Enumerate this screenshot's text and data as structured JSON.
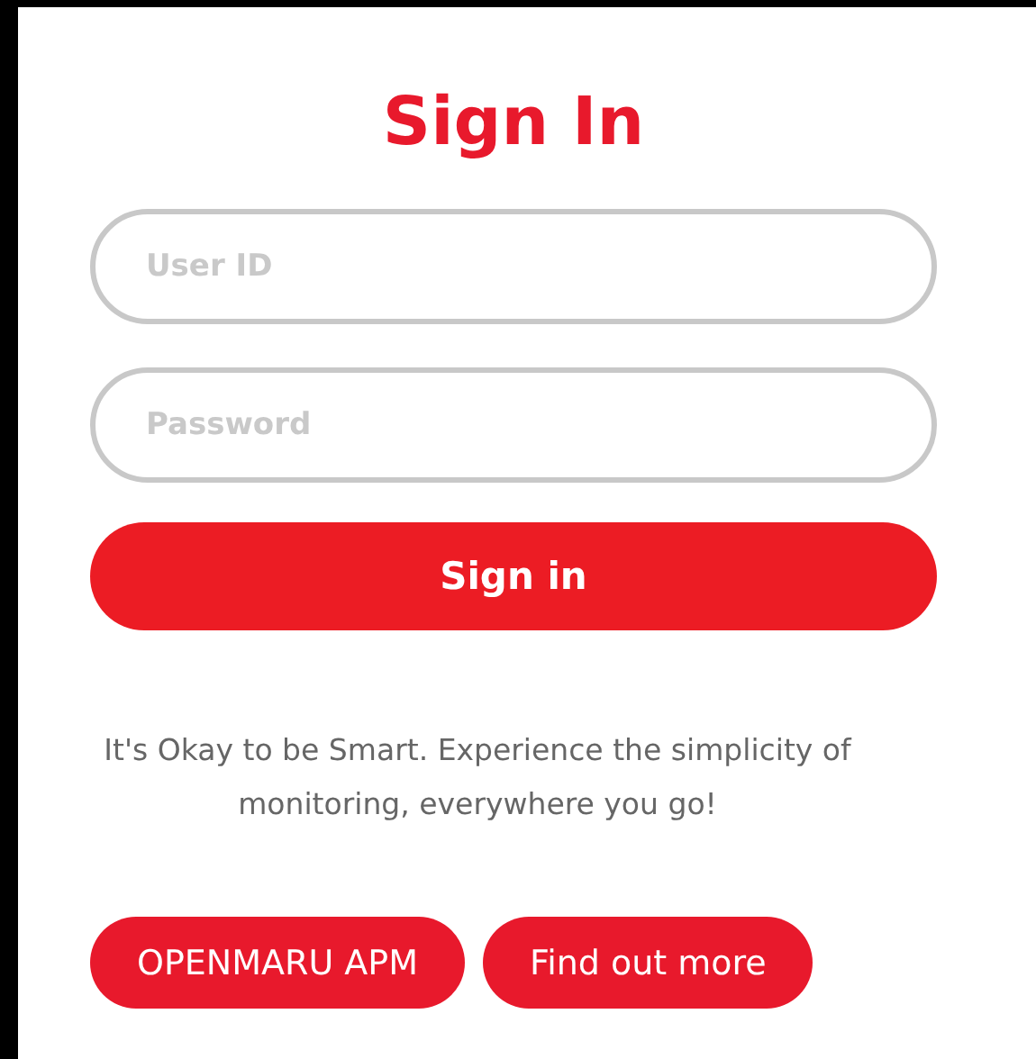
{
  "title": "Sign In",
  "fields": [
    {
      "placeholder": "User ID"
    },
    {
      "placeholder": "Password"
    }
  ],
  "submit": "Sign in",
  "tagline": "It's Okay to be Smart. Experience the simplicity of monitoring, everywhere you go!",
  "links": [
    "OPENMARU APM",
    "Find out more"
  ]
}
